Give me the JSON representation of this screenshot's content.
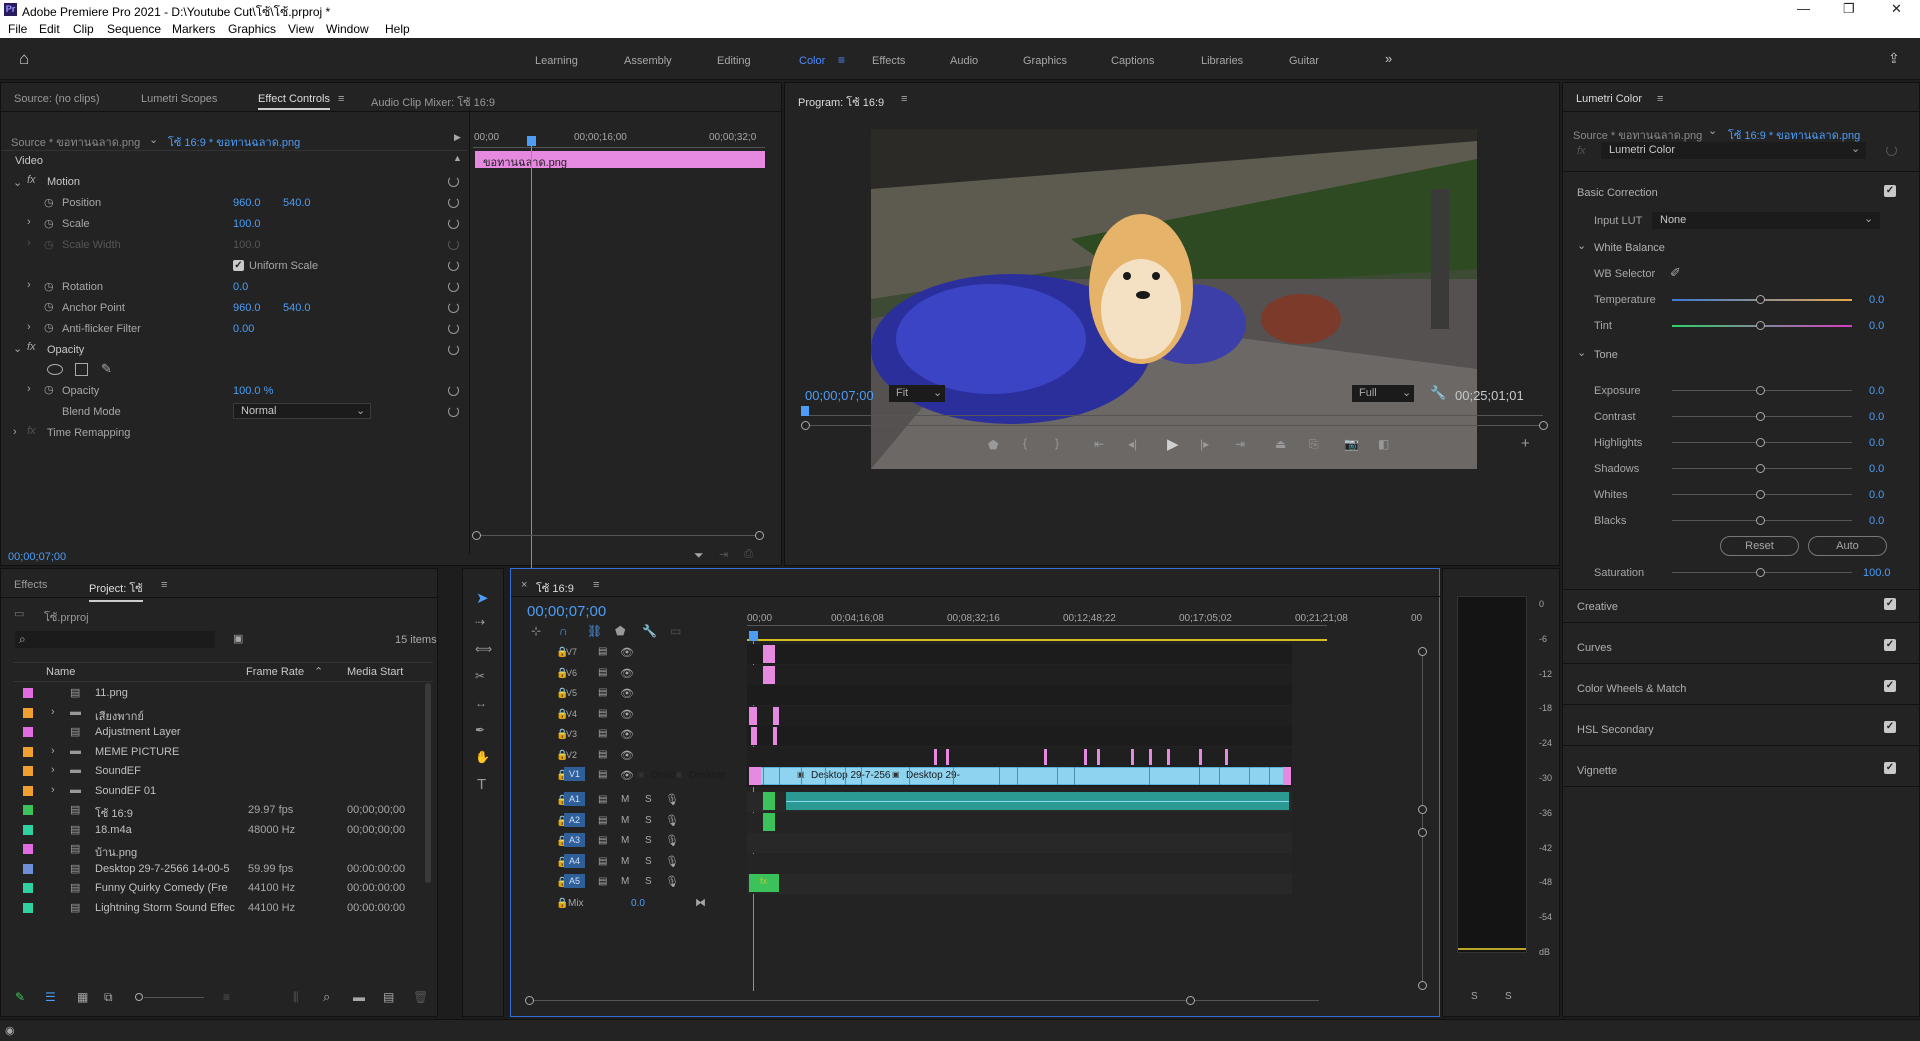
{
  "app": {
    "title": "Adobe Premiere Pro 2021 - D:\\Youtube Cut\\โซ้\\โซ้.prproj *"
  },
  "menu": [
    "File",
    "Edit",
    "Clip",
    "Sequence",
    "Markers",
    "Graphics",
    "View",
    "Window",
    "Help"
  ],
  "workspaces": [
    "Learning",
    "Assembly",
    "Editing",
    "Color",
    "Effects",
    "Audio",
    "Graphics",
    "Captions",
    "Libraries",
    "Guitar"
  ],
  "effect_controls": {
    "tabs": [
      "Source: (no clips)",
      "Lumetri Scopes",
      "Effect Controls",
      "Audio Clip Mixer: โซ้ 16:9"
    ],
    "source_label": "Source * ขอทานฉลาด.png",
    "sequence_label": "โซ้ 16:9 * ขอทานฉลาด.png",
    "ruler": [
      "00;00",
      "00;00;16;00",
      "00;00;32;0"
    ],
    "clip_name": "ขอทานฉลาด.png",
    "video_label": "Video",
    "motion": "Motion",
    "position_label": "Position",
    "position_x": "960.0",
    "position_y": "540.0",
    "scale_label": "Scale",
    "scale": "100.0",
    "scale_width_label": "Scale Width",
    "scale_width": "100.0",
    "uniform_scale": "Uniform Scale",
    "rotation_label": "Rotation",
    "rotation": "0.0",
    "anchor_label": "Anchor Point",
    "anchor_x": "960.0",
    "anchor_y": "540.0",
    "antiflicker_label": "Anti-flicker Filter",
    "antiflicker": "0.00",
    "opacity_section": "Opacity",
    "opacity_label": "Opacity",
    "opacity": "100.0 %",
    "blend_label": "Blend Mode",
    "blend": "Normal",
    "time_remap": "Time Remapping",
    "timecode": "00;00;07;00"
  },
  "program": {
    "title": "Program: โซ้ 16:9",
    "timecode": "00;00;07;00",
    "fit": "Fit",
    "full": "Full",
    "duration": "00;25;01;01"
  },
  "lumetri": {
    "title": "Lumetri Color",
    "source": "Source * ขอทานฉลาด.png",
    "seq": "โซ้ 16:9 * ขอทานฉลาด.png",
    "effect": "Lumetri Color",
    "basic": "Basic Correction",
    "input_lut_label": "Input LUT",
    "input_lut": "None",
    "white_balance": "White Balance",
    "wb_selector": "WB Selector",
    "temperature_label": "Temperature",
    "temperature": "0.0",
    "tint_label": "Tint",
    "tint": "0.0",
    "tone": "Tone",
    "exposure_label": "Exposure",
    "exposure": "0.0",
    "contrast_label": "Contrast",
    "contrast": "0.0",
    "highlights_label": "Highlights",
    "highlights": "0.0",
    "shadows_label": "Shadows",
    "shadows": "0.0",
    "whites_label": "Whites",
    "whites": "0.0",
    "blacks_label": "Blacks",
    "blacks": "0.0",
    "reset": "Reset",
    "auto": "Auto",
    "saturation_label": "Saturation",
    "saturation": "100.0",
    "sections": [
      "Creative",
      "Curves",
      "Color Wheels & Match",
      "HSL Secondary",
      "Vignette"
    ]
  },
  "project": {
    "tabs": [
      "Effects",
      "Project: โซ้"
    ],
    "file": "โซ้.prproj",
    "items_count": "15 items",
    "columns": [
      "Name",
      "Frame Rate",
      "Media Start"
    ],
    "rows": [
      {
        "color": "#e16be0",
        "name": "11.png",
        "rate": "",
        "start": ""
      },
      {
        "color": "#f0a030",
        "name": "เสียงพากย์",
        "rate": "",
        "start": ""
      },
      {
        "color": "#e16be0",
        "name": "Adjustment Layer",
        "rate": "",
        "start": ""
      },
      {
        "color": "#f0a030",
        "name": "MEME PICTURE",
        "rate": "",
        "start": ""
      },
      {
        "color": "#f0a030",
        "name": "SoundEF",
        "rate": "",
        "start": ""
      },
      {
        "color": "#f0a030",
        "name": "SoundEF 01",
        "rate": "",
        "start": ""
      },
      {
        "color": "#3cc25a",
        "name": "โซ้ 16:9",
        "rate": "29.97 fps",
        "start": "00;00;00;00"
      },
      {
        "color": "#2fd1a0",
        "name": "18.m4a",
        "rate": "48000 Hz",
        "start": "00;00;00;00"
      },
      {
        "color": "#e16be0",
        "name": "บ้าน.png",
        "rate": "",
        "start": ""
      },
      {
        "color": "#6d8fd8",
        "name": "Desktop 29-7-2566 14-00-5",
        "rate": "59.99 fps",
        "start": "00:00:00:00"
      },
      {
        "color": "#2fd1a0",
        "name": "Funny Quirky Comedy (Fre",
        "rate": "44100 Hz",
        "start": "00:00:00:00"
      },
      {
        "color": "#2fd1a0",
        "name": "Lightning Storm Sound Effec",
        "rate": "44100 Hz",
        "start": "00:00:00:00"
      }
    ]
  },
  "timeline": {
    "title": "โซ้ 16:9",
    "timecode": "00;00;07;00",
    "ruler": [
      "00;00",
      "00;04;16;08",
      "00;08;32;16",
      "00;12;48;22",
      "00;17;05;02",
      "00;21;21;08",
      "00"
    ],
    "video_tracks": [
      "V7",
      "V6",
      "V5",
      "V4",
      "V3",
      "V2",
      "V1"
    ],
    "audio_tracks": [
      "A1",
      "A2",
      "A3",
      "A4",
      "A5"
    ],
    "mix_label": "Mix",
    "mix": "0.0",
    "clip_labels": [
      "Deskt",
      "Desktop",
      "Desktop 29-7-256",
      "Desktop 29-"
    ]
  },
  "meter": {
    "scale": [
      "0",
      "-6",
      "-12",
      "-18",
      "-24",
      "-30",
      "-36",
      "-42",
      "-48",
      "-54",
      "dB"
    ],
    "solo": [
      "S",
      "S"
    ]
  }
}
